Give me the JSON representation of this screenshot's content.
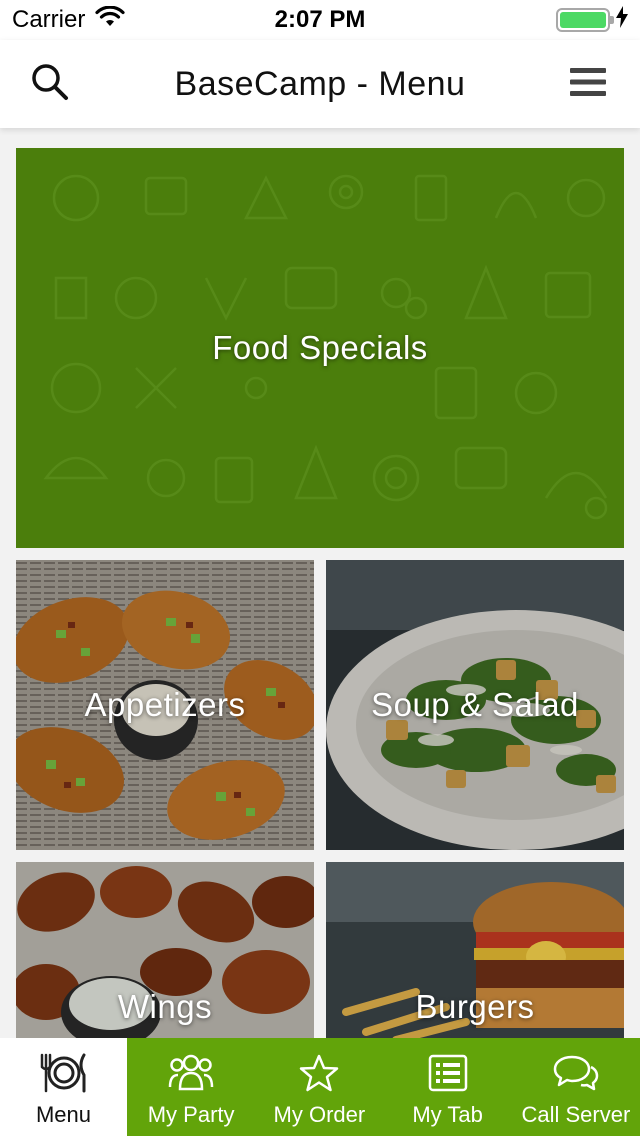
{
  "status_bar": {
    "carrier": "Carrier",
    "time": "2:07 PM",
    "battery_level": 1.0
  },
  "nav": {
    "title": "BaseCamp - Menu",
    "left_icon": "search-icon",
    "right_icon": "hamburger-menu-icon"
  },
  "categories": [
    {
      "label": "Food Specials"
    },
    {
      "label": "Appetizers"
    },
    {
      "label": "Soup & Salad"
    },
    {
      "label": "Wings"
    },
    {
      "label": "Burgers"
    }
  ],
  "tab_bar": {
    "items": [
      {
        "label": "Menu",
        "icon": "plate-cutlery-icon",
        "active": true
      },
      {
        "label": "My Party",
        "icon": "group-icon",
        "active": false
      },
      {
        "label": "My Order",
        "icon": "star-icon",
        "active": false
      },
      {
        "label": "My Tab",
        "icon": "list-icon",
        "active": false
      },
      {
        "label": "Call Server",
        "icon": "chat-bubbles-icon",
        "active": false
      }
    ]
  },
  "colors": {
    "accent_green": "#62a40a",
    "specials_green": "#4b7e0c"
  }
}
